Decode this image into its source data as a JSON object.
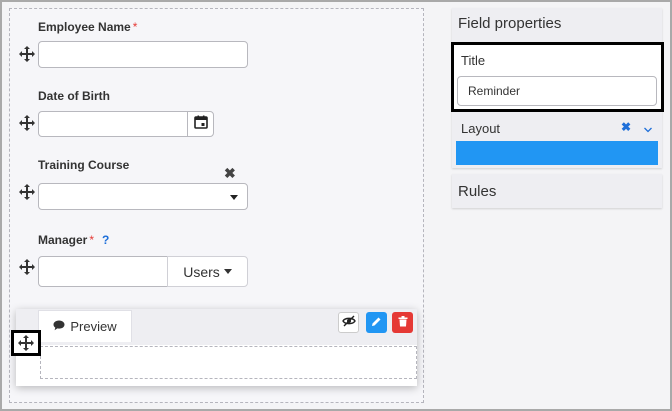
{
  "form": {
    "employee_name": {
      "label": "Employee Name",
      "required": "*",
      "value": ""
    },
    "date_of_birth": {
      "label": "Date of Birth",
      "value": ""
    },
    "training_course": {
      "label": "Training Course",
      "clear": "✖",
      "value": ""
    },
    "manager": {
      "label": "Manager",
      "required": "*",
      "help": "?",
      "value": "",
      "users_button": "Users"
    },
    "reminder": {
      "preview_tab": "Preview"
    }
  },
  "sidebar": {
    "field_properties": "Field properties",
    "title_label": "Title",
    "title_value": "Reminder",
    "layout_label": "Layout",
    "layout_clear": "✖",
    "rules": "Rules"
  },
  "colors": {
    "accent": "#2196f3",
    "danger": "#e53935",
    "required": "#e53935",
    "help": "#1e6fd9"
  },
  "icons": [
    "move-icon",
    "calendar-icon",
    "chevron-down-icon",
    "comment-icon",
    "eye-slash-icon",
    "pencil-icon",
    "trash-icon"
  ]
}
